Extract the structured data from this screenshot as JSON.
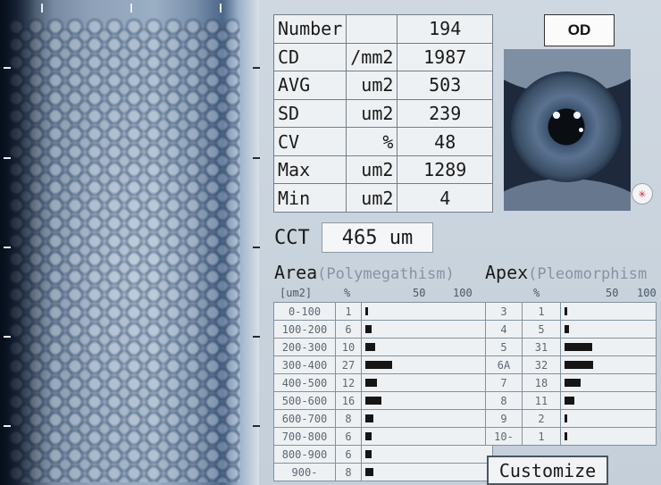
{
  "od_label": "OD",
  "stats": [
    {
      "label": "Number",
      "unit": "",
      "value": "194"
    },
    {
      "label": "CD",
      "unit": "/mm2",
      "value": "1987"
    },
    {
      "label": "AVG",
      "unit": "um2",
      "value": "503"
    },
    {
      "label": "SD",
      "unit": "um2",
      "value": "239"
    },
    {
      "label": "CV",
      "unit": "%",
      "value": "48"
    },
    {
      "label": "Max",
      "unit": "um2",
      "value": "1289"
    },
    {
      "label": "Min",
      "unit": "um2",
      "value": "4"
    }
  ],
  "cct": {
    "label": "CCT",
    "value": "465 um"
  },
  "area": {
    "title": "Area",
    "subtitle": "(Polymegathism)",
    "unit_header": "[um2]",
    "pct_header": "%",
    "scale_50": "50",
    "scale_100": "100",
    "rows": [
      {
        "range": "0-100",
        "pct": "1",
        "value": 1
      },
      {
        "range": "100-200",
        "pct": "6",
        "value": 6
      },
      {
        "range": "200-300",
        "pct": "10",
        "value": 10
      },
      {
        "range": "300-400",
        "pct": "27",
        "value": 27
      },
      {
        "range": "400-500",
        "pct": "12",
        "value": 12
      },
      {
        "range": "500-600",
        "pct": "16",
        "value": 16
      },
      {
        "range": "600-700",
        "pct": "8",
        "value": 8
      },
      {
        "range": "700-800",
        "pct": "6",
        "value": 6
      },
      {
        "range": "800-900",
        "pct": "6",
        "value": 6
      },
      {
        "range": "900-",
        "pct": "8",
        "value": 8
      }
    ]
  },
  "apex": {
    "title": "Apex",
    "subtitle": "(Pleomorphism",
    "pct_header": "%",
    "scale_50": "50",
    "scale_100": "100",
    "rows": [
      {
        "n": "3",
        "pct": "1",
        "value": 1
      },
      {
        "n": "4",
        "pct": "5",
        "value": 5
      },
      {
        "n": "5",
        "pct": "31",
        "value": 31
      },
      {
        "n": "6A",
        "pct": "32",
        "value": 32
      },
      {
        "n": "7",
        "pct": "18",
        "value": 18
      },
      {
        "n": "8",
        "pct": "11",
        "value": 11
      },
      {
        "n": "9",
        "pct": "2",
        "value": 2
      },
      {
        "n": "10-",
        "pct": "1",
        "value": 1
      }
    ]
  },
  "customize_label": "Customize",
  "icons": {
    "eye_settings": "target-icon"
  },
  "colors": {
    "bar": "#151515",
    "panel": "#eef1f3"
  }
}
